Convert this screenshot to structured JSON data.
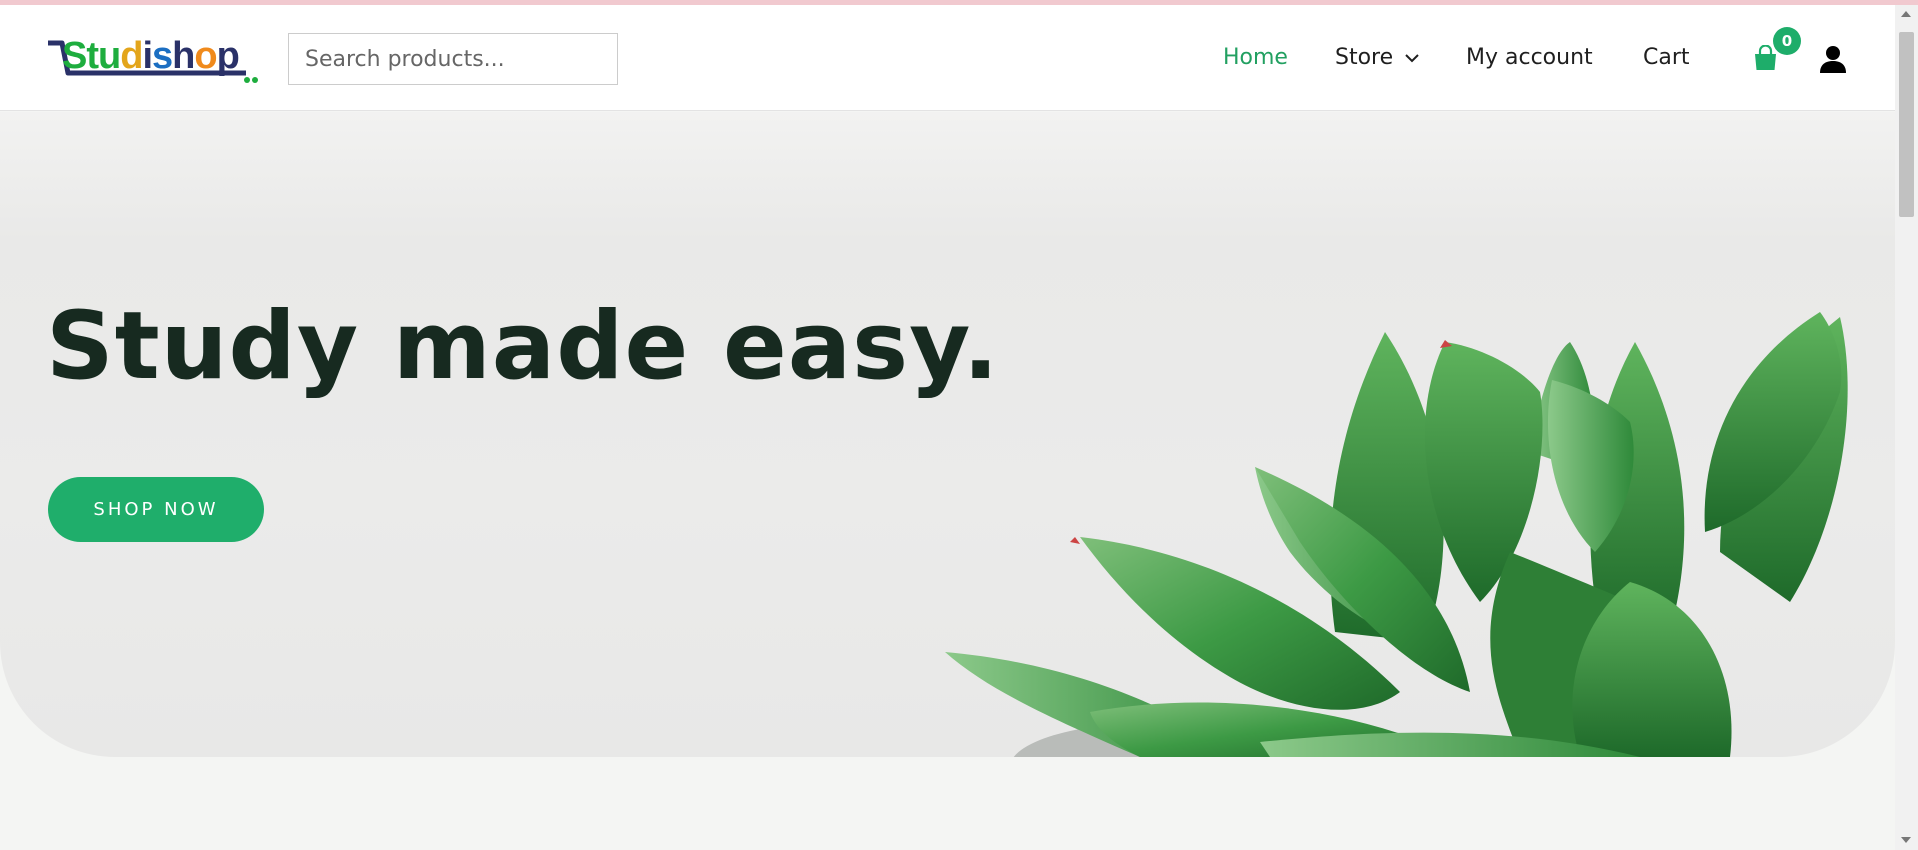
{
  "header": {
    "logo_text": "Studishop",
    "search_placeholder": "Search products...",
    "nav": {
      "home": "Home",
      "store": "Store",
      "my_account": "My account",
      "cart": "Cart"
    },
    "cart_count": "0"
  },
  "hero": {
    "title": "Study made easy.",
    "button_label": "SHOP NOW"
  },
  "colors": {
    "accent": "#1fae6b",
    "nav_active": "#22a061",
    "hero_text": "#172a20"
  },
  "icons": [
    "cart-bag-icon",
    "user-icon",
    "chevron-down-icon",
    "succulent-plant-image"
  ]
}
